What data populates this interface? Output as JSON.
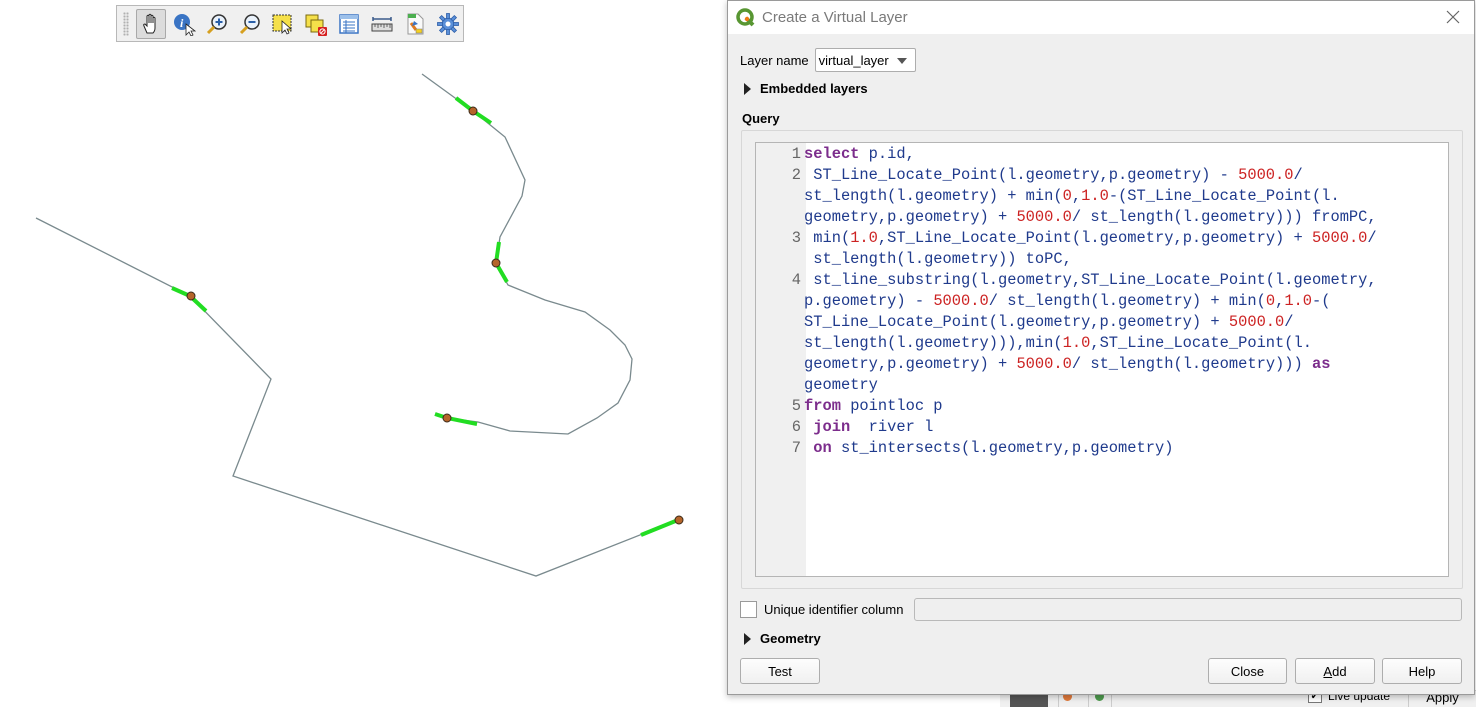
{
  "toolbar": {
    "tools": [
      {
        "name": "pan-icon",
        "active": true
      },
      {
        "name": "identify-icon",
        "active": false
      },
      {
        "name": "zoom-in-icon",
        "active": false
      },
      {
        "name": "zoom-out-icon",
        "active": false
      },
      {
        "name": "select-feature-icon",
        "active": false
      },
      {
        "name": "deselect-icon",
        "active": false
      },
      {
        "name": "attribute-table-icon",
        "active": false
      },
      {
        "name": "measure-icon",
        "active": false
      },
      {
        "name": "field-calculator-icon",
        "active": false
      },
      {
        "name": "settings-icon",
        "active": false
      }
    ]
  },
  "map": {
    "background": "#ffffff",
    "line_color": "#7a8a8e",
    "highlight_color": "#22dd22",
    "point_fill": "#b5652a",
    "point_stroke": "#3a2a1a"
  },
  "dialog": {
    "title": "Create a Virtual Layer",
    "layer_name_label": "Layer name",
    "layer_name_value": "virtual_layer",
    "embedded_layers_label": "Embedded layers",
    "query_label": "Query",
    "query_lines": [
      {
        "n": "1",
        "html": "<span class=\"kw\">select</span> p.id,"
      },
      {
        "n": "2",
        "html": " ST_Line_Locate_Point(l.geometry,p.geometry) - <span class=\"num\">5000.0</span>/"
      },
      {
        "n": "",
        "html": "st_length(l.geometry) + min(<span class=\"num\">0</span>,<span class=\"num\">1.0</span>-(ST_Line_Locate_Point(l."
      },
      {
        "n": "",
        "html": "geometry,p.geometry) + <span class=\"num\">5000.0</span>/ st_length(l.geometry))) fromPC,"
      },
      {
        "n": "3",
        "html": " min(<span class=\"num\">1.0</span>,ST_Line_Locate_Point(l.geometry,p.geometry) + <span class=\"num\">5000.0</span>/"
      },
      {
        "n": "",
        "html": " st_length(l.geometry)) toPC,"
      },
      {
        "n": "4",
        "html": " st_line_substring(l.geometry,ST_Line_Locate_Point(l.geometry,"
      },
      {
        "n": "",
        "html": "p.geometry) - <span class=\"num\">5000.0</span>/ st_length(l.geometry) + min(<span class=\"num\">0</span>,<span class=\"num\">1.0</span>-("
      },
      {
        "n": "",
        "html": "ST_Line_Locate_Point(l.geometry,p.geometry) + <span class=\"num\">5000.0</span>/"
      },
      {
        "n": "",
        "html": "st_length(l.geometry))),min(<span class=\"num\">1.0</span>,ST_Line_Locate_Point(l."
      },
      {
        "n": "",
        "html": "geometry,p.geometry) + <span class=\"num\">5000.0</span>/ st_length(l.geometry))) <span class=\"kw\">as</span>"
      },
      {
        "n": "",
        "html": "geometry"
      },
      {
        "n": "5",
        "html": "<span class=\"kw\">from</span> pointloc p"
      },
      {
        "n": "6",
        "html": " <span class=\"kw\">join</span>  river l"
      },
      {
        "n": "7",
        "html": " <span class=\"kw\">on</span> st_intersects(l.geometry,p.geometry)"
      }
    ],
    "unique_id_label": "Unique identifier column",
    "unique_id_checked": false,
    "unique_id_value": "",
    "geometry_label": "Geometry",
    "buttons": {
      "test": "Test",
      "close": "Close",
      "add": "Add",
      "add_mnemonic": "A",
      "help": "Help"
    }
  },
  "background_panel": {
    "live_update_label": "Live update",
    "live_update_checked": true,
    "apply_label": "Apply"
  }
}
